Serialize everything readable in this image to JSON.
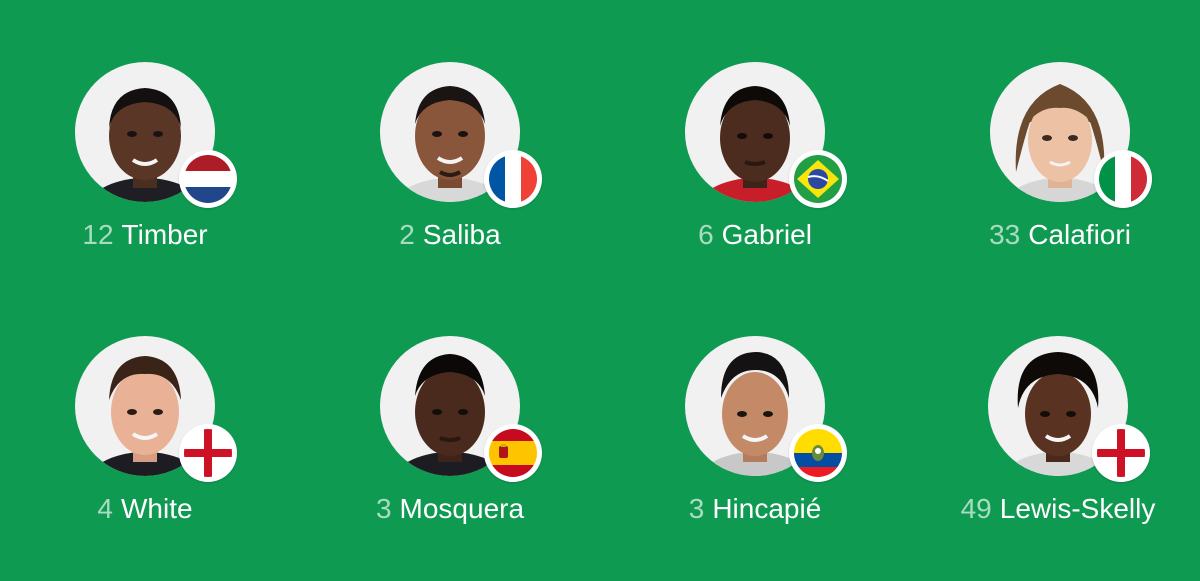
{
  "colors": {
    "pitch_green": "#0f9a52",
    "number_color": "#a9dcbf",
    "name_color": "#ffffff",
    "avatar_bg": "#f1f1f1"
  },
  "players": [
    {
      "number": "12",
      "name": "Timber",
      "flag": "netherlands-flag-icon"
    },
    {
      "number": "2",
      "name": "Saliba",
      "flag": "france-flag-icon"
    },
    {
      "number": "6",
      "name": "Gabriel",
      "flag": "brazil-flag-icon"
    },
    {
      "number": "33",
      "name": "Calafiori",
      "flag": "italy-flag-icon"
    },
    {
      "number": "4",
      "name": "White",
      "flag": "england-flag-icon"
    },
    {
      "number": "3",
      "name": "Mosquera",
      "flag": "spain-flag-icon"
    },
    {
      "number": "3",
      "name": "Hincapié",
      "flag": "ecuador-flag-icon"
    },
    {
      "number": "49",
      "name": "Lewis-Skelly",
      "flag": "england-flag-icon"
    }
  ]
}
